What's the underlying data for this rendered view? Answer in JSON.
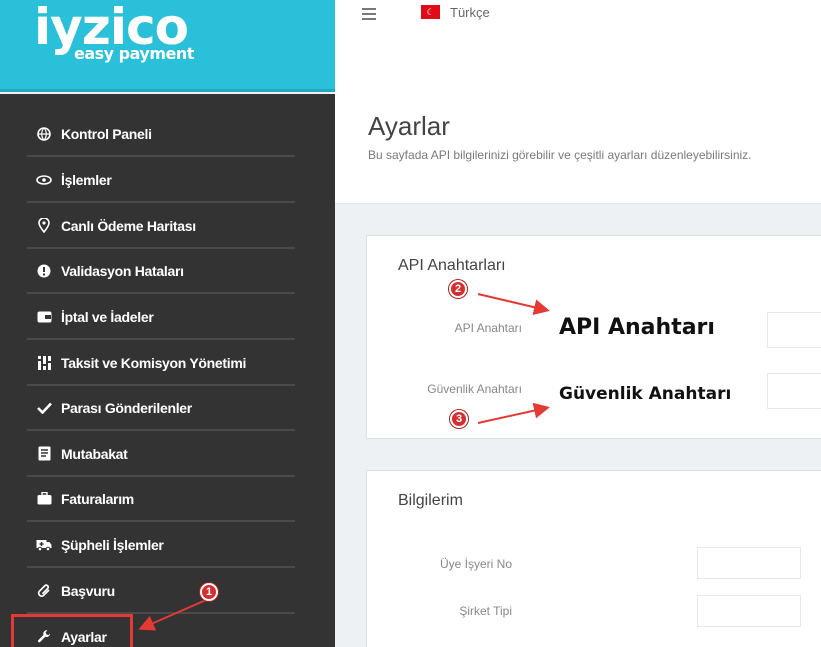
{
  "logo": {
    "main": "iyzico",
    "sub": "easy payment"
  },
  "header": {
    "lang": "Türkçe"
  },
  "page": {
    "title": "Ayarlar",
    "subtitle": "Bu sayfada API bilgilerinizi görebilir ve çeşitli ayarları düzenleyebilirsiniz."
  },
  "sidebar": {
    "items": [
      {
        "label": "Kontrol Paneli",
        "icon": "globe-icon"
      },
      {
        "label": "İşlemler",
        "icon": "eye-icon"
      },
      {
        "label": "Canlı Ödeme Haritası",
        "icon": "map-pin-icon"
      },
      {
        "label": "Validasyon Hataları",
        "icon": "alert-icon"
      },
      {
        "label": "İptal ve İadeler",
        "icon": "wallet-icon"
      },
      {
        "label": "Taksit ve Komisyon Yönetimi",
        "icon": "sliders-icon"
      },
      {
        "label": "Parası Gönderilenler",
        "icon": "check-icon"
      },
      {
        "label": "Mutabakat",
        "icon": "document-icon"
      },
      {
        "label": "Faturalarım",
        "icon": "briefcase-icon"
      },
      {
        "label": "Şüpheli İşlemler",
        "icon": "ambulance-icon"
      },
      {
        "label": "Başvuru",
        "icon": "paperclip-icon"
      },
      {
        "label": "Ayarlar",
        "icon": "wrench-icon"
      }
    ]
  },
  "api_card": {
    "title": "API Anahtarları",
    "api_key_label": "API Anahtarı",
    "api_key_value": "API Anahtarı",
    "secret_key_label": "Güvenlik Anahtarı",
    "secret_key_value": "Güvenlik Anahtarı"
  },
  "info_card": {
    "title": "Bilgilerim",
    "member_no_label": "Üye İşyeri No",
    "company_type_label": "Şirket Tipi"
  },
  "markers": [
    "1",
    "2",
    "3"
  ],
  "colors": {
    "brand": "#2bc0d9",
    "sidebar": "#333333",
    "highlight": "#e53935"
  }
}
